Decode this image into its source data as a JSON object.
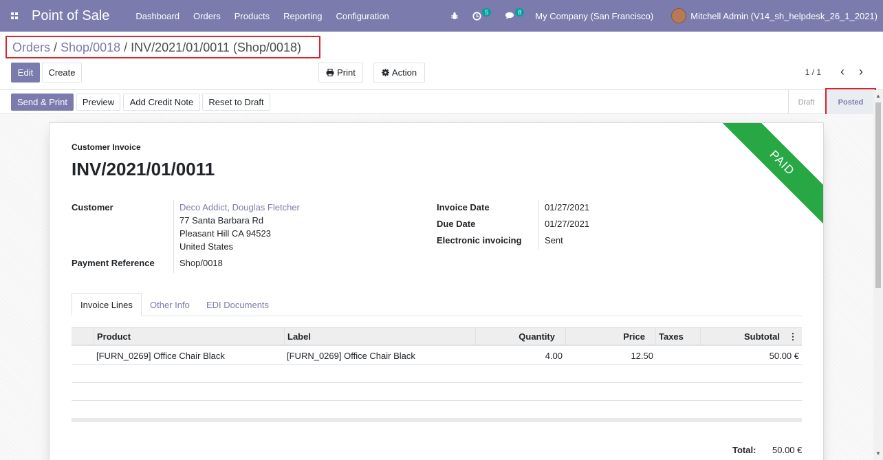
{
  "navbar": {
    "app_name": "Point of Sale",
    "menu": [
      "Dashboard",
      "Orders",
      "Products",
      "Reporting",
      "Configuration"
    ],
    "activity_count": "5",
    "message_count": "8",
    "company": "My Company (San Francisco)",
    "user": "Mitchell Admin (V14_sh_helpdesk_26_1_2021)"
  },
  "breadcrumb": {
    "orders": "Orders",
    "sep1": " / ",
    "shop": "Shop/0018",
    "sep2": " / ",
    "current": "INV/2021/01/0011 (Shop/0018)"
  },
  "control": {
    "edit_label": "Edit",
    "create_label": "Create",
    "print_label": "Print",
    "action_label": "Action",
    "pager": "1 / 1"
  },
  "status_actions": {
    "send_print": "Send & Print",
    "preview": "Preview",
    "credit_note": "Add Credit Note",
    "reset_draft": "Reset to Draft"
  },
  "status_stages": {
    "draft": "Draft",
    "posted": "Posted",
    "active": "Posted"
  },
  "invoice": {
    "ribbon": "PAID",
    "type_label": "Customer Invoice",
    "number": "INV/2021/01/0011",
    "customer_label": "Customer",
    "customer_name": "Deco Addict, Douglas Fletcher",
    "address_line1": "77 Santa Barbara Rd",
    "address_line2": "Pleasant Hill CA 94523",
    "address_line3": "United States",
    "payment_ref_label": "Payment Reference",
    "payment_ref": "Shop/0018",
    "invoice_date_label": "Invoice Date",
    "invoice_date": "01/27/2021",
    "due_date_label": "Due Date",
    "due_date": "01/27/2021",
    "einvoicing_label": "Electronic invoicing",
    "einvoicing": "Sent"
  },
  "tabs": [
    "Invoice Lines",
    "Other Info",
    "EDI Documents"
  ],
  "lines": {
    "headers": {
      "product": "Product",
      "label": "Label",
      "quantity": "Quantity",
      "price": "Price",
      "taxes": "Taxes",
      "subtotal": "Subtotal"
    },
    "rows": [
      {
        "product": "[FURN_0269] Office Chair Black",
        "label": "[FURN_0269] Office Chair Black",
        "quantity": "4.00",
        "price": "12.50",
        "taxes": "",
        "subtotal": "50.00 €"
      }
    ]
  },
  "totals": {
    "total_label": "Total:",
    "total": "50.00 €"
  },
  "colors": {
    "brand": "#7c7bad",
    "paid_ribbon": "#28a745",
    "highlight_box": "#d9232d"
  }
}
